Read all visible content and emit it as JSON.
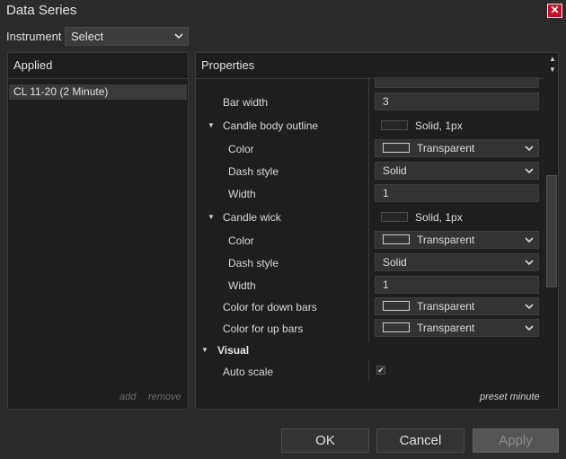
{
  "window": {
    "title": "Data Series",
    "close_glyph": "✕"
  },
  "instrument": {
    "label": "Instrument",
    "value": "Select"
  },
  "applied": {
    "header": "Applied",
    "items": [
      "CL 11-20 (2 Minute)"
    ],
    "add": "add",
    "remove": "remove"
  },
  "properties": {
    "header": "Properties",
    "bar_width": {
      "label": "Bar width",
      "value": "3"
    },
    "candle_body_outline": {
      "label": "Candle body outline",
      "summary": "Solid, 1px",
      "color": {
        "label": "Color",
        "value": "Transparent"
      },
      "dash": {
        "label": "Dash style",
        "value": "Solid"
      },
      "width": {
        "label": "Width",
        "value": "1"
      }
    },
    "candle_wick": {
      "label": "Candle wick",
      "summary": "Solid, 1px",
      "color": {
        "label": "Color",
        "value": "Transparent"
      },
      "dash": {
        "label": "Dash style",
        "value": "Solid"
      },
      "width": {
        "label": "Width",
        "value": "1"
      }
    },
    "down_bars": {
      "label": "Color for down bars",
      "value": "Transparent"
    },
    "up_bars": {
      "label": "Color for up bars",
      "value": "Transparent"
    },
    "visual": {
      "label": "Visual"
    },
    "auto_scale": {
      "label": "Auto scale",
      "checked": true
    },
    "preset": "preset minute"
  },
  "buttons": {
    "ok": "OK",
    "cancel": "Cancel",
    "apply": "Apply"
  },
  "colors": {
    "background": "#2b2b2b",
    "panel": "#1e1e1e",
    "close": "#c8102e"
  }
}
